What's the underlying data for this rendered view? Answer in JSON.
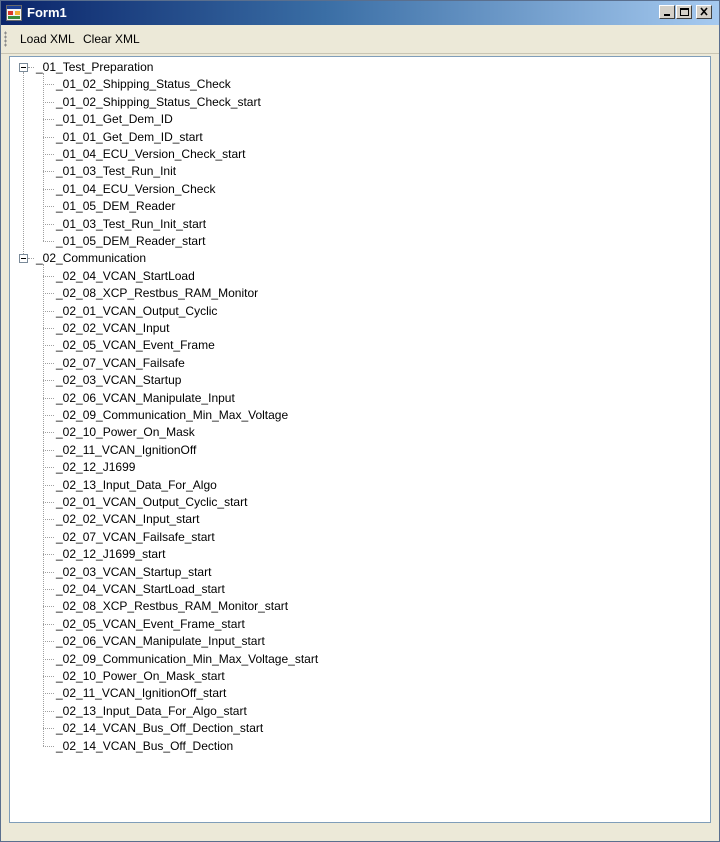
{
  "window": {
    "title": "Form1",
    "icon": "winforms-app-icon",
    "controls": [
      "minimize-icon",
      "maximize-icon",
      "close-icon"
    ]
  },
  "toolbar": {
    "load_label": "Load XML",
    "clear_label": "Clear XML"
  },
  "tree": {
    "groups": [
      {
        "label": "_01_Test_Preparation",
        "expanded": true,
        "children": [
          "_01_02_Shipping_Status_Check",
          "_01_02_Shipping_Status_Check_start",
          "_01_01_Get_Dem_ID",
          "_01_01_Get_Dem_ID_start",
          "_01_04_ECU_Version_Check_start",
          "_01_03_Test_Run_Init",
          "_01_04_ECU_Version_Check",
          "_01_05_DEM_Reader",
          "_01_03_Test_Run_Init_start",
          "_01_05_DEM_Reader_start"
        ]
      },
      {
        "label": "_02_Communication",
        "expanded": true,
        "children": [
          "_02_04_VCAN_StartLoad",
          "_02_08_XCP_Restbus_RAM_Monitor",
          "_02_01_VCAN_Output_Cyclic",
          "_02_02_VCAN_Input",
          "_02_05_VCAN_Event_Frame",
          "_02_07_VCAN_Failsafe",
          "_02_03_VCAN_Startup",
          "_02_06_VCAN_Manipulate_Input",
          "_02_09_Communication_Min_Max_Voltage",
          "_02_10_Power_On_Mask",
          "_02_11_VCAN_IgnitionOff",
          "_02_12_J1699",
          "_02_13_Input_Data_For_Algo",
          "_02_01_VCAN_Output_Cyclic_start",
          "_02_02_VCAN_Input_start",
          "_02_07_VCAN_Failsafe_start",
          "_02_12_J1699_start",
          "_02_03_VCAN_Startup_start",
          "_02_04_VCAN_StartLoad_start",
          "_02_08_XCP_Restbus_RAM_Monitor_start",
          "_02_05_VCAN_Event_Frame_start",
          "_02_06_VCAN_Manipulate_Input_start",
          "_02_09_Communication_Min_Max_Voltage_start",
          "_02_10_Power_On_Mask_start",
          "_02_11_VCAN_IgnitionOff_start",
          "_02_13_Input_Data_For_Algo_start",
          "_02_14_VCAN_Bus_Off_Dection_start",
          "_02_14_VCAN_Bus_Off_Dection"
        ]
      }
    ]
  }
}
